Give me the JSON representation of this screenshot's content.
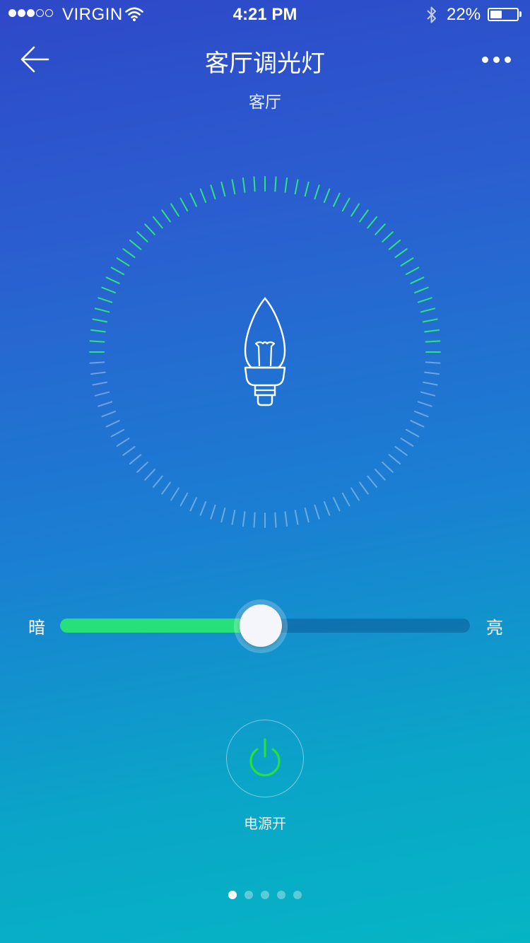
{
  "status_bar": {
    "signal_filled": 3,
    "signal_total": 5,
    "carrier": "VIRGIN",
    "time": "4:21 PM",
    "battery_percent_text": "22%",
    "battery_level": 0.45,
    "icons": [
      "signal-dots-icon",
      "wifi-icon",
      "bluetooth-icon",
      "battery-icon"
    ]
  },
  "nav": {
    "title": "客厅调光灯",
    "back_icon": "arrow-left-icon",
    "more_icon": "more-dots-icon"
  },
  "room": {
    "label": "客厅"
  },
  "dial": {
    "tick_count": 100,
    "level": 0.5,
    "active_color": "#2ee37d",
    "inactive_color": "rgba(255,255,255,0.35)",
    "center_icon": "candle-bulb-icon"
  },
  "brightness": {
    "min_label": "暗",
    "max_label": "亮",
    "value": 0.5,
    "fill_color": "#28e07a"
  },
  "power": {
    "label": "电源开",
    "state": "on",
    "icon": "power-icon",
    "icon_color": "#27e03a"
  },
  "pagination": {
    "count": 5,
    "active_index": 0
  }
}
